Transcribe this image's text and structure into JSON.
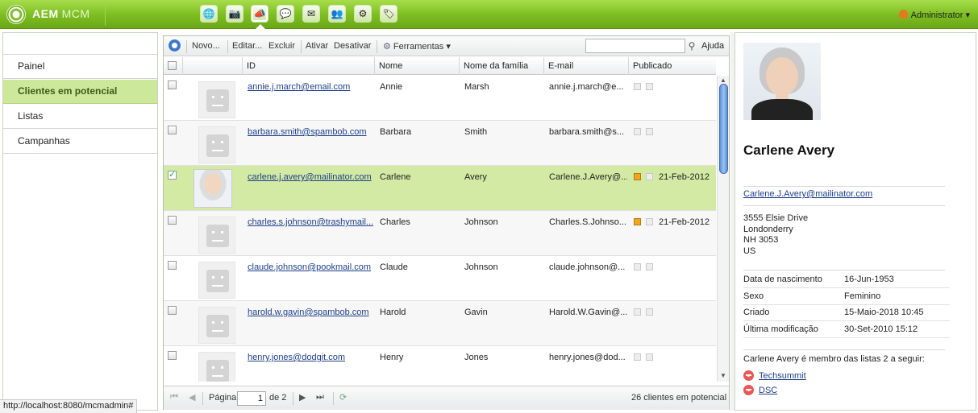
{
  "app": {
    "brand_main": "AEM",
    "brand_sub": "MCM",
    "apps": [
      {
        "icon": "globe-icon",
        "glyph": "🌐"
      },
      {
        "icon": "camera-icon",
        "glyph": "📷"
      },
      {
        "icon": "megaphone-icon",
        "glyph": "📣"
      },
      {
        "icon": "speech-bubble-icon",
        "glyph": "💬"
      },
      {
        "icon": "mail-icon",
        "glyph": "✉"
      },
      {
        "icon": "people-icon",
        "glyph": "👥"
      },
      {
        "icon": "gears-icon",
        "glyph": "⚙"
      },
      {
        "icon": "tag-icon",
        "glyph": "🏷"
      }
    ],
    "user_label": "Administrator ▾"
  },
  "nav": {
    "items": [
      {
        "label": "Painel",
        "selected": false
      },
      {
        "label": "Clientes em potencial",
        "selected": true
      },
      {
        "label": "Listas",
        "selected": false
      },
      {
        "label": "Campanhas",
        "selected": false
      }
    ]
  },
  "toolbar": {
    "new_label": "Novo...",
    "edit_label": "Editar...",
    "delete_label": "Excluir",
    "activate_label": "Ativar",
    "deactivate_label": "Desativar",
    "tools_label": "Ferramentas ▾",
    "search_value": "",
    "help_label": "Ajuda"
  },
  "grid": {
    "columns": [
      "ID",
      "Nome",
      "Nome da família",
      "E-mail",
      "Publicado"
    ],
    "rows": [
      {
        "id": "annie.j.march@email.com",
        "first": "Annie",
        "last": "Marsh",
        "email": "annie.j.march@e...",
        "published": "",
        "checked": false,
        "has_photo": false
      },
      {
        "id": "barbara.smith@spambob.com",
        "first": "Barbara",
        "last": "Smith",
        "email": "barbara.smith@s...",
        "published": "",
        "checked": false,
        "has_photo": false
      },
      {
        "id": "carlene.j.avery@mailinator.com",
        "first": "Carlene",
        "last": "Avery",
        "email": "Carlene.J.Avery@...",
        "published": "21-Feb-2012",
        "checked": true,
        "has_photo": true
      },
      {
        "id": "charles.s.johnson@trashymail...",
        "first": "Charles",
        "last": "Johnson",
        "email": "Charles.S.Johnso...",
        "published": "21-Feb-2012",
        "checked": false,
        "has_photo": false
      },
      {
        "id": "claude.johnson@pookmail.com",
        "first": "Claude",
        "last": "Johnson",
        "email": "claude.johnson@...",
        "published": "",
        "checked": false,
        "has_photo": false
      },
      {
        "id": "harold.w.gavin@spambob.com",
        "first": "Harold",
        "last": "Gavin",
        "email": "Harold.W.Gavin@...",
        "published": "",
        "checked": false,
        "has_photo": false
      },
      {
        "id": "henry.jones@dodgit.com",
        "first": "Henry",
        "last": "Jones",
        "email": "henry.jones@dod...",
        "published": "",
        "checked": false,
        "has_photo": false
      }
    ]
  },
  "pager": {
    "page_label": "Página",
    "page_value": "1",
    "of_label": "de 2",
    "summary": "26 clientes em potencial"
  },
  "detail": {
    "name": "Carlene Avery",
    "email": "Carlene.J.Avery@mailinator.com",
    "address": [
      "3555 Elsie Drive",
      "Londonderry",
      "NH 3053",
      "US"
    ],
    "fields": [
      {
        "key": "Data de nascimento",
        "value": "16-Jun-1953"
      },
      {
        "key": "Sexo",
        "value": "Feminino"
      },
      {
        "key": "Criado",
        "value": "15-Maio-2018 10:45"
      },
      {
        "key": "Última modificação",
        "value": "30-Set-2010 15:12"
      }
    ],
    "lists_text": "Carlene Avery é membro das listas  2  a seguir:",
    "lists": [
      "Techsummit",
      "DSC"
    ]
  },
  "status": {
    "url": "http://localhost:8080/mcmadmin#"
  }
}
